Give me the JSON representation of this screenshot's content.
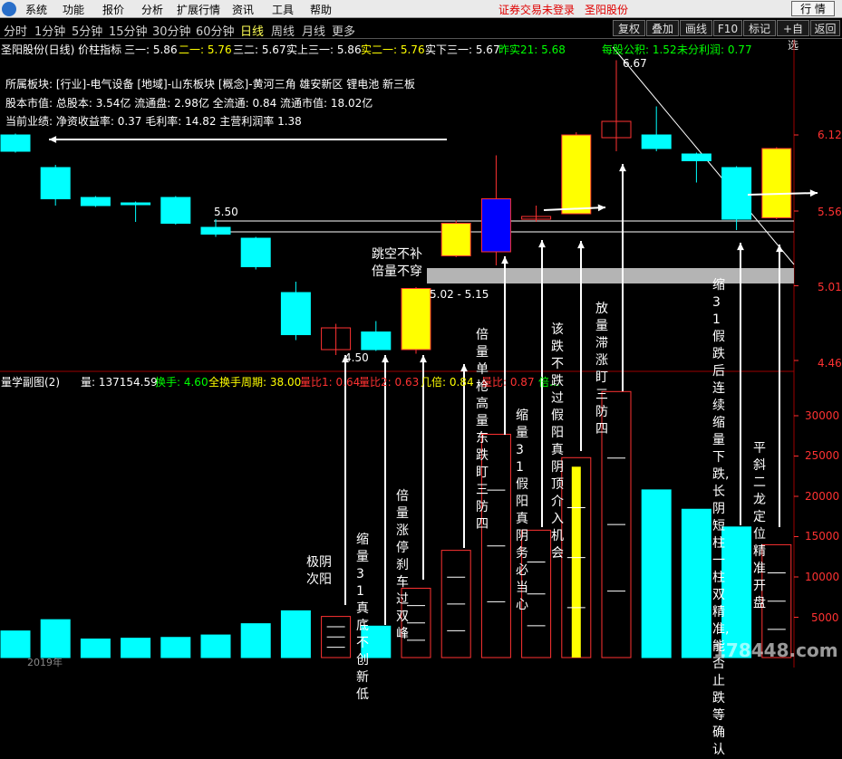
{
  "menu": {
    "items": [
      "系统",
      "功能",
      "报价",
      "分析",
      "扩展行情",
      "资讯",
      "工具",
      "帮助"
    ],
    "notice": "证券交易未登录",
    "stock_name": "圣阳股份",
    "quote_button": "行 情"
  },
  "period_bar": {
    "periods": [
      "分时",
      "1分钟",
      "5分钟",
      "15分钟",
      "30分钟",
      "60分钟",
      "日线",
      "周线",
      "月线",
      "更多"
    ],
    "active": "日线",
    "tools": [
      "复权",
      "叠加",
      "画线",
      "F10",
      "标记",
      "+自选",
      "返回"
    ]
  },
  "main_chart": {
    "title": "圣阳股份(日线) 价柱指标",
    "indicators": [
      {
        "label": "三一: 5.86",
        "color": "#ffffff"
      },
      {
        "label": "二一: 5.76",
        "color": "#ffff00"
      },
      {
        "label": "三二: 5.67",
        "color": "#ffffff"
      },
      {
        "label": "实上三一: 5.86",
        "color": "#ffffff"
      },
      {
        "label": "实二一: 5.76",
        "color": "#ffff00"
      },
      {
        "label": "实下三一: 5.67",
        "color": "#ffffff"
      },
      {
        "label": "昨实21: 5.68",
        "color": "#00ff00"
      }
    ],
    "eps": "每股公积: 1.52",
    "undistributed": "未分利润: 0.77",
    "info_lines": [
      "所属板块: [行业]-电气设备 [地域]-山东板块 [概念]-黄河三角 雄安新区 锂电池 新三板",
      "股本市值: 总股本: 3.54亿 流通盘: 2.98亿 全流通: 0.84 流通市值: 18.02亿",
      "当前业绩: 净资收益率: 0.37 毛利率: 14.82 主营利润率 1.38"
    ],
    "price_labels": [
      "6.12",
      "5.56",
      "5.01",
      "4.46"
    ],
    "high_label": "6.67",
    "low_label": "4.50",
    "level_label": "5.50",
    "gap_label": "5.02 - 5.15"
  },
  "sub_chart": {
    "title": "量学副图(2)",
    "indicators": [
      {
        "label": "量: 137154.59",
        "color": "#ffffff"
      },
      {
        "label": "换手: 4.60",
        "color": "#00ff00"
      },
      {
        "label": "全换手周期: 38.00",
        "color": "#ffff00"
      },
      {
        "label": "量比1: 0.64",
        "color": "#ff3232"
      },
      {
        "label": "量比2: 0.63",
        "color": "#ff3232"
      },
      {
        "label": "几倍: 0.84",
        "color": "#ffff00"
      },
      {
        "label": "量比: 0.87",
        "color": "#ff3232"
      },
      {
        "label": "倍...",
        "color": "#00ff00"
      }
    ],
    "volume_labels": [
      "30000",
      "25000",
      "20000",
      "15000",
      "10000",
      "5000"
    ],
    "watermark": "178448.com",
    "bottom_partial": "2019年"
  },
  "chart_data": {
    "type": "candlestick",
    "price_axis": {
      "ticks": [
        6.12,
        5.56,
        5.01,
        4.46
      ]
    },
    "volume_axis": {
      "ticks": [
        30000,
        25000,
        20000,
        15000,
        10000,
        5000
      ]
    },
    "candles": [
      {
        "open": 6.0,
        "close": 6.12,
        "high": 6.13,
        "low": 5.99,
        "color": "cyan",
        "vol": 3300
      },
      {
        "open": 5.88,
        "close": 5.65,
        "high": 5.9,
        "low": 5.6,
        "color": "cyan",
        "vol": 4700
      },
      {
        "open": 5.66,
        "close": 5.6,
        "high": 5.67,
        "low": 5.59,
        "color": "cyan",
        "vol": 2300
      },
      {
        "open": 5.62,
        "close": 5.61,
        "high": 5.63,
        "low": 5.48,
        "color": "cyan",
        "vol": 2400
      },
      {
        "open": 5.66,
        "close": 5.47,
        "high": 5.67,
        "low": 5.46,
        "color": "cyan",
        "vol": 2500
      },
      {
        "open": 5.39,
        "close": 5.44,
        "high": 5.5,
        "low": 5.37,
        "color": "cyan",
        "vol": 2800
      },
      {
        "open": 5.36,
        "close": 5.15,
        "high": 5.37,
        "low": 5.13,
        "color": "cyan",
        "vol": 4200
      },
      {
        "open": 4.96,
        "close": 4.65,
        "high": 5.04,
        "low": 4.61,
        "color": "cyan",
        "vol": 5800
      },
      {
        "open": 4.7,
        "close": 4.54,
        "high": 4.73,
        "low": 4.5,
        "color": "hollow",
        "vol": 5100
      },
      {
        "open": 4.67,
        "close": 4.54,
        "high": 4.75,
        "low": 4.53,
        "color": "cyan",
        "vol": 3900
      },
      {
        "open": 4.54,
        "close": 4.99,
        "high": 5.0,
        "low": 4.51,
        "color": "yellow",
        "vol": 8600
      },
      {
        "open": 5.23,
        "close": 5.47,
        "high": 5.49,
        "low": 5.22,
        "color": "yellow",
        "vol": 13300
      },
      {
        "open": 5.65,
        "close": 5.26,
        "high": 5.97,
        "low": 5.16,
        "color": "blue",
        "vol": 27700
      },
      {
        "open": 5.5,
        "close": 5.52,
        "high": 5.6,
        "low": 5.48,
        "color": "hollow",
        "vol": 15800
      },
      {
        "open": 5.54,
        "close": 6.12,
        "high": 6.14,
        "low": 5.54,
        "color": "yellow",
        "vol": 24800
      },
      {
        "open": 6.1,
        "close": 6.22,
        "high": 6.67,
        "low": 6.0,
        "color": "hollow",
        "vol": 33000
      },
      {
        "open": 6.12,
        "close": 6.02,
        "high": 6.33,
        "low": 6.0,
        "color": "cyan",
        "vol": 20800
      },
      {
        "open": 5.98,
        "close": 5.93,
        "high": 5.99,
        "low": 5.77,
        "color": "cyan",
        "vol": 18400
      },
      {
        "open": 5.88,
        "close": 5.5,
        "high": 5.89,
        "low": 5.42,
        "color": "cyan",
        "vol": 16200
      },
      {
        "open": 5.51,
        "close": 6.02,
        "high": 6.03,
        "low": 5.5,
        "color": "yellow",
        "vol": 14000
      }
    ],
    "annotations": [
      "跳空不补\n倍量不穿",
      "极阴\n次阳",
      "缩量31真底不创新低",
      "倍量涨停刹车过双峰",
      "倍量单枪高量东跌盯三防四",
      "缩量31假阳真阴务必当心",
      "该跌不跌过假阳真阴顶介入机会",
      "放量滞涨盯三防四",
      "缩31假跌后连续缩量下跌,长阴短柱一柱双精准,能否止跌等确认",
      "平斜二龙定位精准开盘"
    ]
  }
}
